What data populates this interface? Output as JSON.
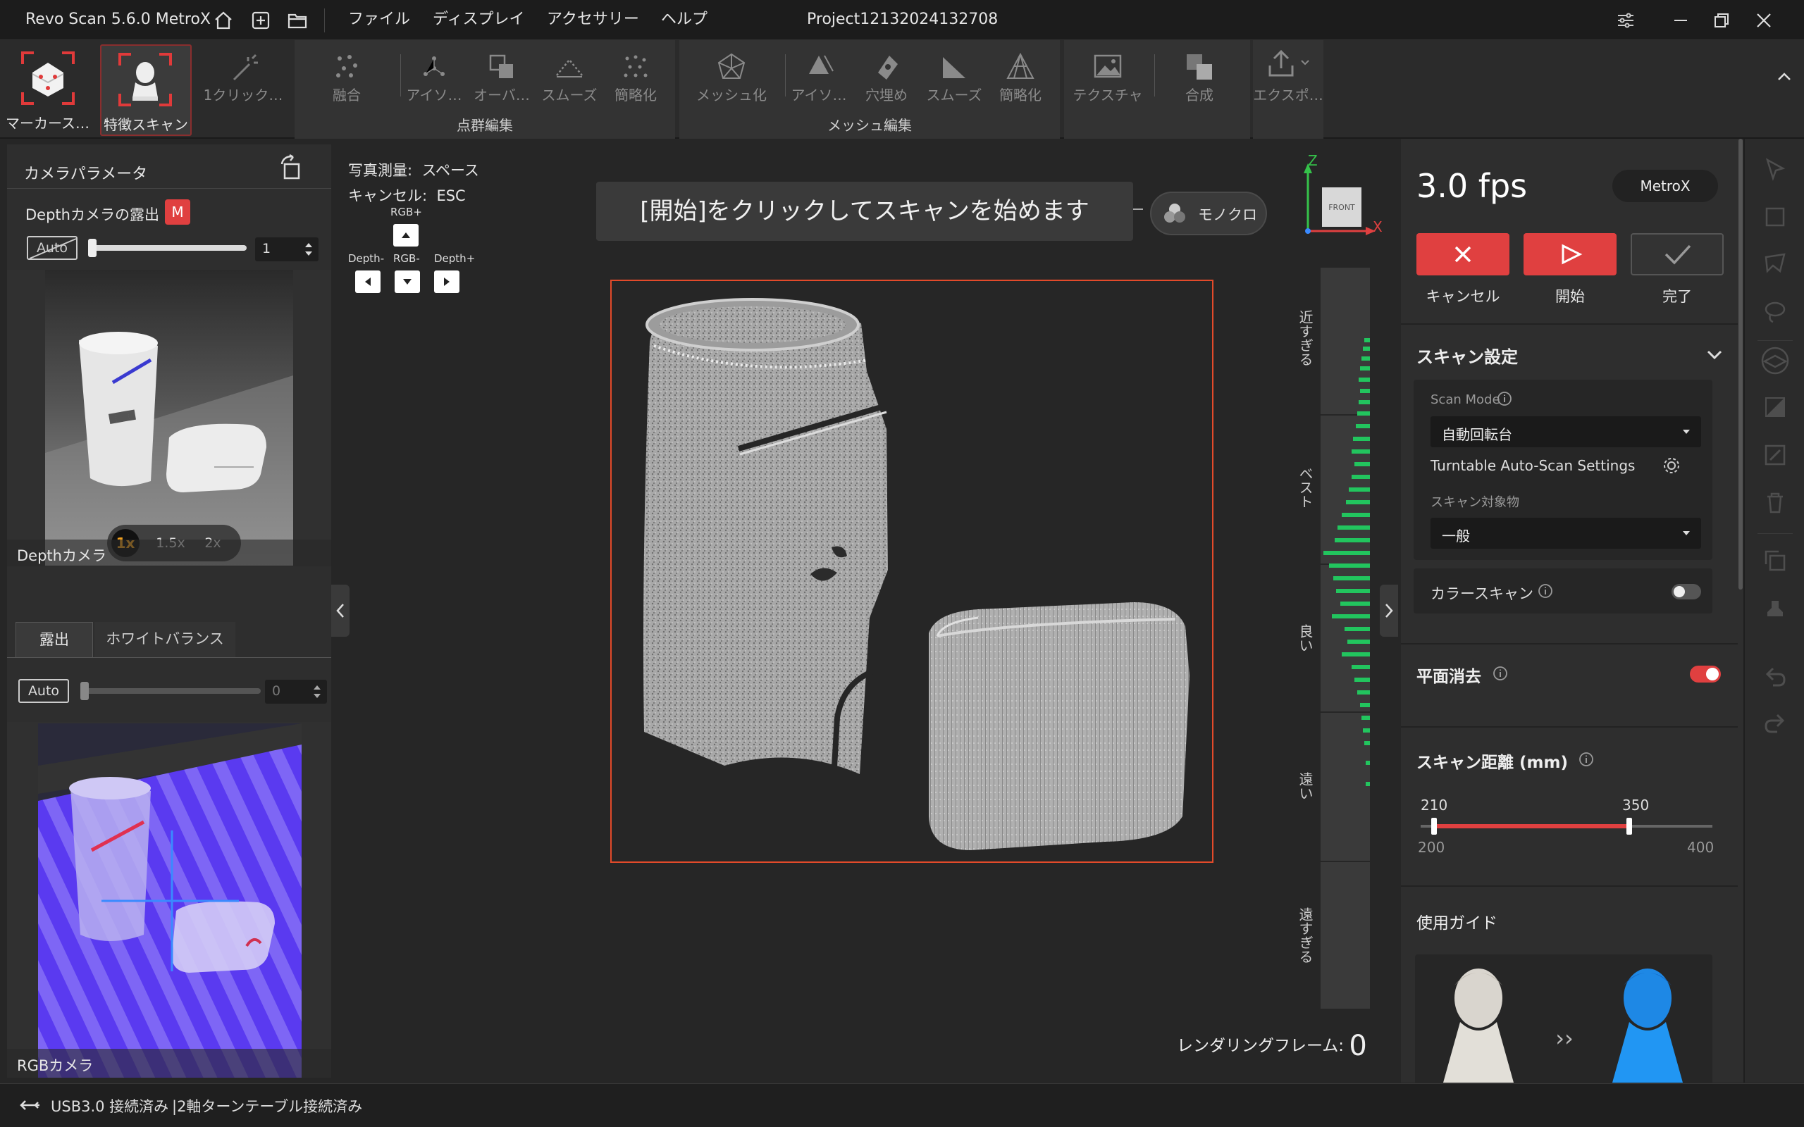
{
  "window": {
    "app_title": "Revo Scan 5.6.0 MetroX",
    "project_title": "Project12132024132708"
  },
  "menu": [
    "ファイル",
    "ディスプレイ",
    "アクセサリー",
    "ヘルプ"
  ],
  "ribbon": {
    "modes": [
      {
        "label": "マーカース…",
        "icon": "marker-scan-icon"
      },
      {
        "label": "特徴スキャン",
        "icon": "feature-scan-icon",
        "active": true
      }
    ],
    "one_click": "1クリック…",
    "point_cloud_group": {
      "title": "点群編集",
      "items": [
        "融合",
        "アイソ…",
        "オーバ…",
        "スムーズ",
        "簡略化"
      ]
    },
    "mesh_group": {
      "title": "メッシュ編集",
      "items": [
        "メッシュ化",
        "アイソ…",
        "穴埋め",
        "スムーズ",
        "簡略化"
      ]
    },
    "texture": "テクスチャ",
    "merge": "合成",
    "export": "エクスポ…"
  },
  "left_panel": {
    "title": "カメラパラメータ",
    "depth_exposure_label": "Depthカメラの露出",
    "badge": "M",
    "auto_label": "Auto",
    "depth_exposure_value": "1",
    "zoom_options": [
      "1x",
      "1.5x",
      "2x"
    ],
    "zoom_selected": "1x",
    "depth_camera_label": "Depthカメラ",
    "tabs": [
      "露出",
      "ホワイトバランス"
    ],
    "rgb_auto_label": "Auto",
    "rgb_exposure_value": "0",
    "rgb_camera_label": "RGBカメラ"
  },
  "viewport": {
    "hint_photogrammetry_key": "写真測量:",
    "hint_photogrammetry_val": "スペース",
    "hint_cancel_key": "キャンセル:",
    "hint_cancel_val": "ESC",
    "cam_controls": {
      "up": "RGB+",
      "left": "Depth-",
      "mid": "RGB-",
      "right": "Depth+"
    },
    "banner": "[開始]をクリックしてスキャンを始めます",
    "mono_label": "モノクロ",
    "axes": {
      "z": "Z",
      "x": "X",
      "cube": "FRONT"
    },
    "distance_labels": [
      "近すぎる",
      "ベスト",
      "良い",
      "遠い",
      "遠すぎる"
    ],
    "render_frame_label": "レンダリングフレーム:",
    "render_frame_value": "0"
  },
  "right_panel": {
    "fps": "3.0 fps",
    "device": "MetroX",
    "cancel": "キャンセル",
    "start": "開始",
    "done": "完了",
    "scan_settings": "スキャン設定",
    "scan_mode_label": "Scan Mode",
    "scan_mode_value": "自動回転台",
    "turntable_settings": "Turntable Auto-Scan Settings",
    "target_label": "スキャン対象物",
    "target_value": "一般",
    "color_scan": "カラースキャン",
    "color_scan_on": false,
    "plane_removal": "平面消去",
    "plane_removal_on": true,
    "scan_distance": "スキャン距離 (mm)",
    "range_low": "210",
    "range_high": "350",
    "range_min": "200",
    "range_max": "400",
    "guide": "使用ガイド"
  },
  "status": {
    "usb": "USB3.0 接続済み",
    "turntable": "|2軸ターンテーブル接続済み"
  },
  "colors": {
    "accent_red": "#e04040",
    "histogram_green": "#22c55e",
    "toggle_on": "#e04040"
  }
}
